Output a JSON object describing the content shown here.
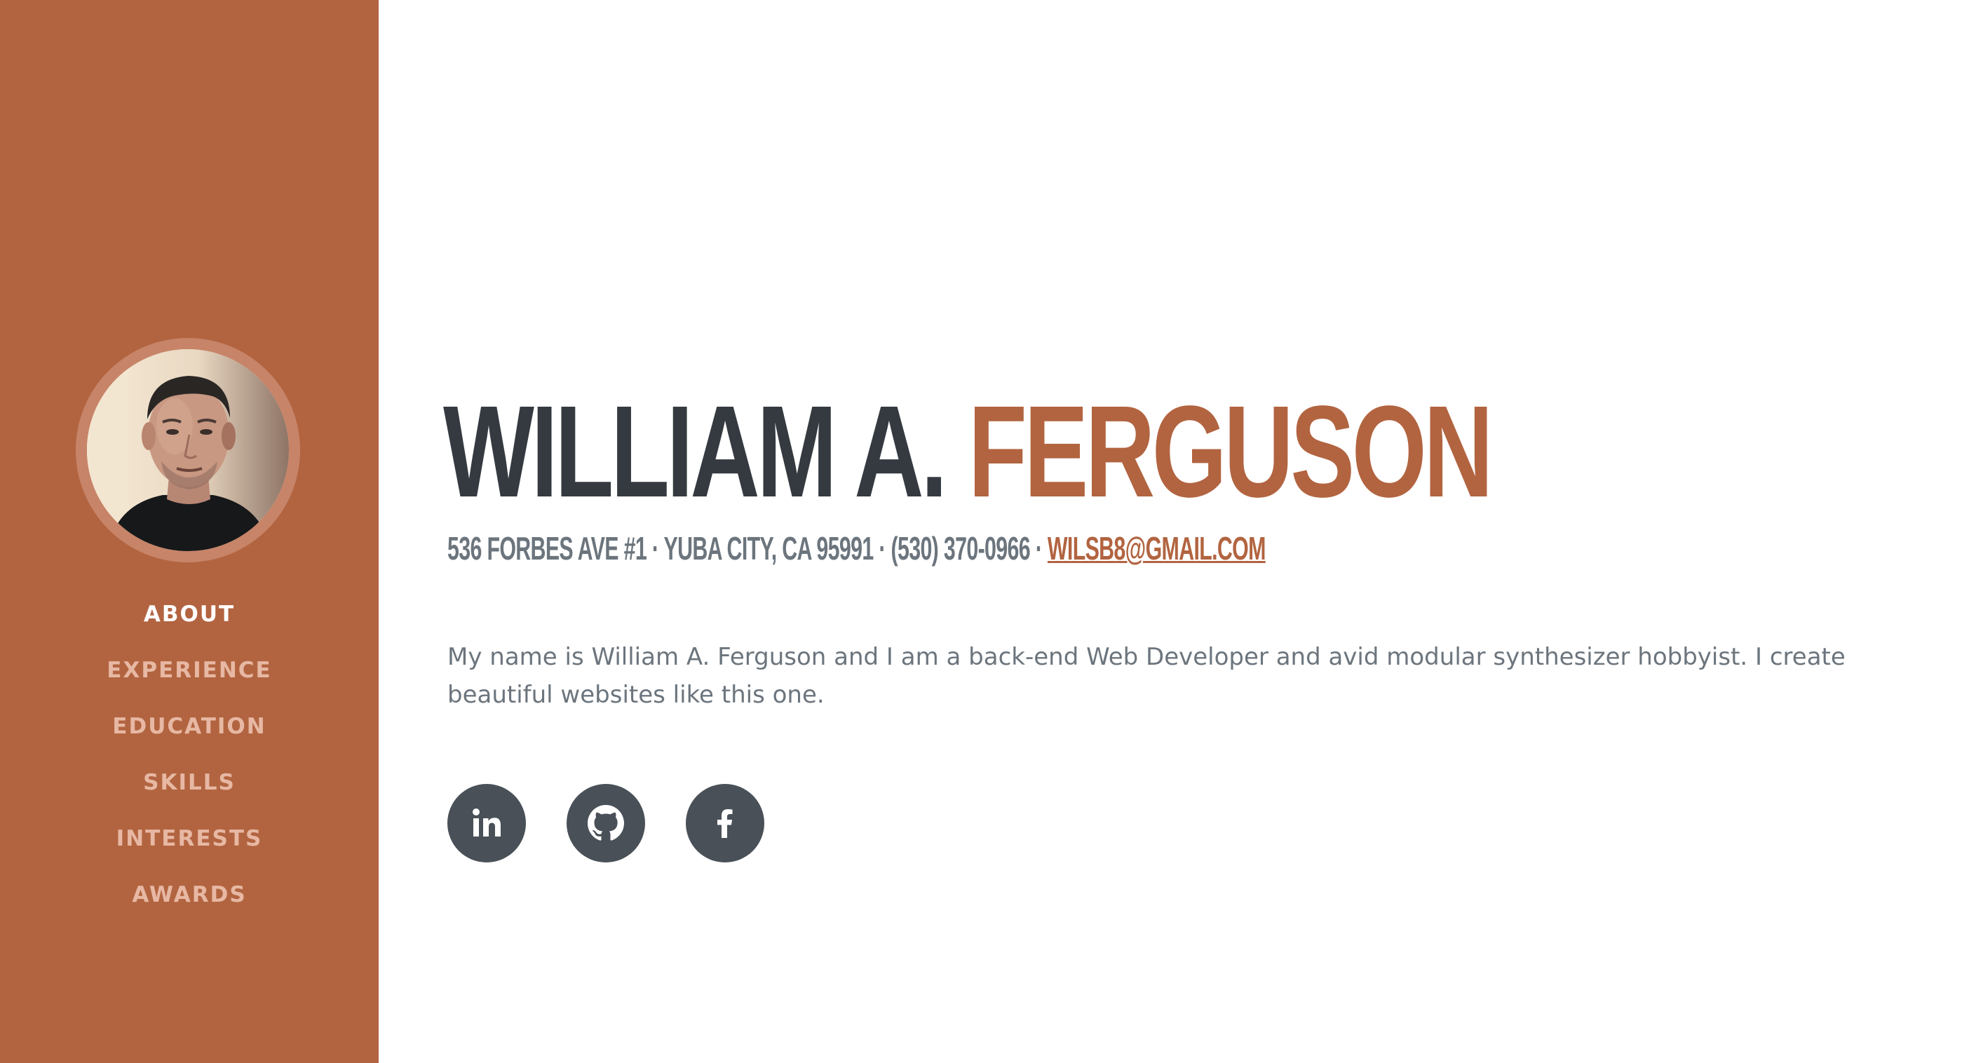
{
  "sidebar": {
    "avatar_alt": "Profile photo of William A. Ferguson",
    "nav": [
      {
        "label": "About",
        "active": true
      },
      {
        "label": "Experience"
      },
      {
        "label": "Education"
      },
      {
        "label": "Skills"
      },
      {
        "label": "Interests"
      },
      {
        "label": "Awards"
      }
    ]
  },
  "about": {
    "first_name": "WILLIAM A.",
    "last_name": "FERGUSON",
    "address": "536 Forbes Ave #1 · Yuba City, CA 95991 · (530) 370-0966 · ",
    "email": "wilsb8@gmail.com",
    "bio": "My name is William A. Ferguson and I am a back-end Web Developer and avid modular synthesizer hobbyist. I create beautiful websites like this one.",
    "social": [
      {
        "name": "linkedin-icon"
      },
      {
        "name": "github-icon"
      },
      {
        "name": "facebook-icon"
      }
    ]
  },
  "colors": {
    "accent": "#b26440",
    "nav_inactive": "#e7b8a3",
    "heading": "#343a40",
    "text": "#6c757d",
    "social_bg": "#495057"
  }
}
